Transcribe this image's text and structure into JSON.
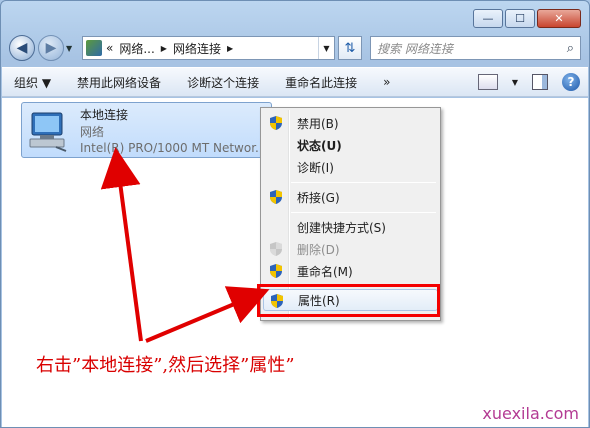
{
  "window": {
    "minimize_glyph": "—",
    "maximize_glyph": "☐",
    "close_glyph": "✕"
  },
  "nav": {
    "back_glyph": "◀",
    "forward_glyph": "▶",
    "breadcrumb": [
      "«",
      "网络...",
      "▶",
      "网络连接",
      "▶"
    ],
    "search_placeholder": "搜索 网络连接",
    "search_icon": "magnifier-icon"
  },
  "commandbar": {
    "items": [
      "组织 ▼",
      "禁用此网络设备",
      "诊断这个连接",
      "重命名此连接",
      "»"
    ],
    "help_glyph": "?"
  },
  "connection": {
    "name": "本地连接",
    "status": "网络",
    "adapter": "Intel(R) PRO/1000 MT Networ..."
  },
  "context_menu": {
    "items": [
      {
        "label": "禁用(B)",
        "icon": "shield-icon"
      },
      {
        "label": "状态(U)",
        "icon": "none"
      },
      {
        "label": "诊断(I)",
        "icon": "none"
      },
      {
        "label": "桥接(G)",
        "icon": "shield-icon"
      },
      {
        "label": "创建快捷方式(S)",
        "icon": "none"
      },
      {
        "label": "删除(D)",
        "icon": "shield-icon"
      },
      {
        "label": "重命名(M)",
        "icon": "shield-icon"
      },
      {
        "label": "属性(R)",
        "icon": "shield-icon"
      }
    ]
  },
  "annotation": {
    "text": "右击”本地连接”,然后选择”属性”",
    "color": "#d90000"
  },
  "watermark": "xuexila.com"
}
